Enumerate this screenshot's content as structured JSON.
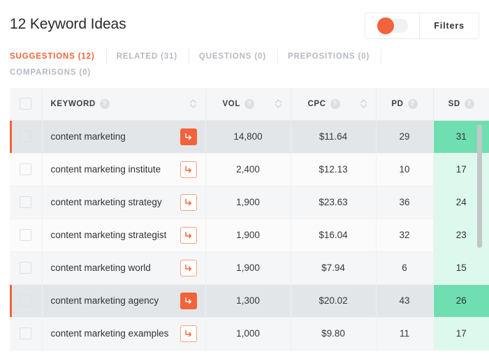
{
  "header": {
    "title": "12 Keyword Ideas",
    "toggle": {
      "name": "results-toggle",
      "state": "on",
      "accent": "#f1633a"
    },
    "filters_label": "Filters"
  },
  "tabs": [
    {
      "label": "SUGGESTIONS (12)",
      "active": true
    },
    {
      "label": "RELATED (31)",
      "active": false
    },
    {
      "label": "QUESTIONS (0)",
      "active": false
    },
    {
      "label": "PREPOSITIONS (0)",
      "active": false
    },
    {
      "label": "COMPARISONS (0)",
      "active": false
    }
  ],
  "table": {
    "columns": [
      {
        "key": "check",
        "label": "",
        "help": false,
        "sort": false
      },
      {
        "key": "keyword",
        "label": "KEYWORD",
        "help": true,
        "sort": true
      },
      {
        "key": "vol",
        "label": "VOL",
        "help": true,
        "sort": true
      },
      {
        "key": "cpc",
        "label": "CPC",
        "help": true,
        "sort": true
      },
      {
        "key": "pd",
        "label": "PD",
        "help": true,
        "sort": false
      },
      {
        "key": "sd",
        "label": "SD",
        "help": true,
        "sort": false
      }
    ],
    "help_glyph": "?",
    "rows": [
      {
        "keyword": "content marketing",
        "vol": "14,800",
        "cpc": "$11.64",
        "pd": "29",
        "sd": "31",
        "highlighted": true,
        "arrow_filled": true
      },
      {
        "keyword": "content marketing institute",
        "vol": "2,400",
        "cpc": "$12.13",
        "pd": "10",
        "sd": "17",
        "highlighted": false,
        "arrow_filled": false
      },
      {
        "keyword": "content marketing strategy",
        "vol": "1,900",
        "cpc": "$23.63",
        "pd": "36",
        "sd": "24",
        "highlighted": false,
        "arrow_filled": false
      },
      {
        "keyword": "content marketing strategist",
        "vol": "1,900",
        "cpc": "$16.04",
        "pd": "32",
        "sd": "23",
        "highlighted": false,
        "arrow_filled": false
      },
      {
        "keyword": "content marketing world",
        "vol": "1,900",
        "cpc": "$7.94",
        "pd": "6",
        "sd": "15",
        "highlighted": false,
        "arrow_filled": false
      },
      {
        "keyword": "content marketing agency",
        "vol": "1,300",
        "cpc": "$20.02",
        "pd": "43",
        "sd": "26",
        "highlighted": true,
        "arrow_filled": true
      },
      {
        "keyword": "content marketing examples",
        "vol": "1,000",
        "cpc": "$9.80",
        "pd": "11",
        "sd": "17",
        "highlighted": false,
        "arrow_filled": false
      }
    ]
  },
  "colors": {
    "accent": "#f1633a",
    "sd_light": "#ddf8ec",
    "sd_strong": "#6fdfb2",
    "row_highlight": "#e3e6e9",
    "muted_text": "#b5babf"
  }
}
